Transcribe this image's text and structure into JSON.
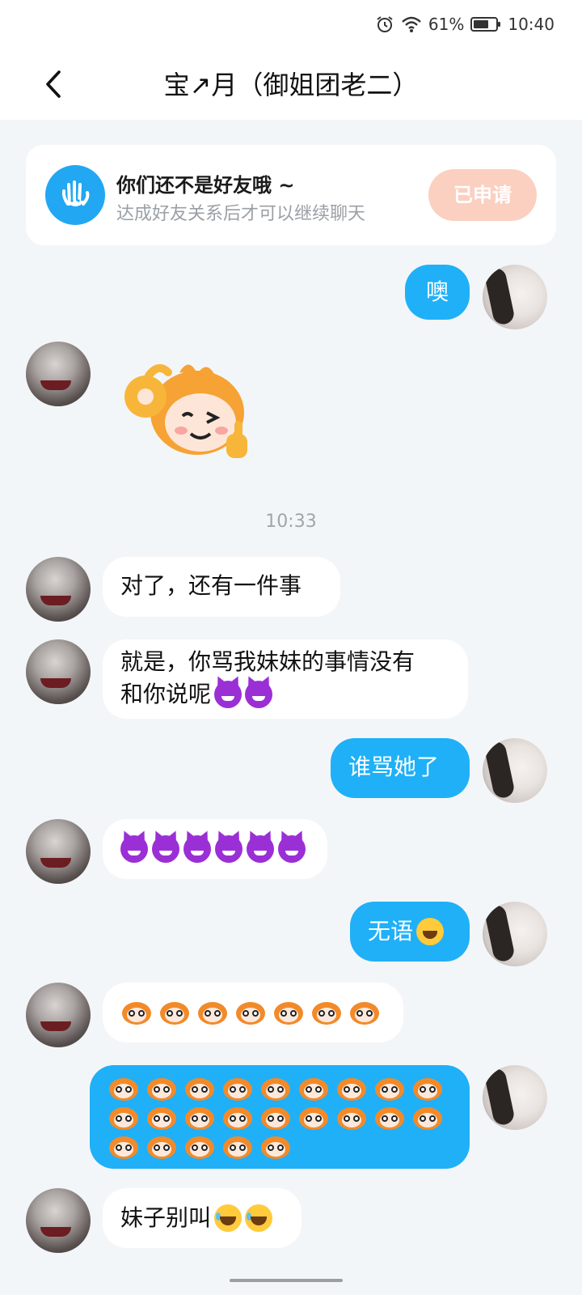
{
  "status": {
    "battery": "61%",
    "time": "10:40",
    "icons": [
      "alarm-icon",
      "wifi-icon",
      "battery-icon"
    ]
  },
  "header": {
    "title": "宝↗月（御姐团老二）",
    "back_icon": "chevron-left-icon"
  },
  "banner": {
    "title": "你们还不是好友哦 ~",
    "subtitle": "达成好友关系后才可以继续聊天",
    "button": "已申请",
    "icon": "hand-wave-icon"
  },
  "chat": {
    "timestamp": "10:33",
    "messages": [
      {
        "side": "right",
        "type": "text",
        "text": "噢"
      },
      {
        "side": "left",
        "type": "sticker",
        "sticker": "monkey-ok-wink-sticker"
      },
      {
        "side": "left",
        "type": "text",
        "text": "对了，还有一件事"
      },
      {
        "side": "left",
        "type": "text",
        "text_line1": "就是，你骂我妹妹的事情没有",
        "text_line2": "和你说呢",
        "emoji": "devil-emoji",
        "emoji_count": 2
      },
      {
        "side": "right",
        "type": "text",
        "text": "谁骂她了"
      },
      {
        "side": "left",
        "type": "emoji",
        "emoji": "devil-emoji",
        "emoji_count": 6
      },
      {
        "side": "right",
        "type": "text",
        "text": "无语",
        "emoji": "sweat-smile-emoji",
        "emoji_count": 1
      },
      {
        "side": "left",
        "type": "emoji",
        "emoji": "monkey-face-emoji",
        "emoji_count": 7
      },
      {
        "side": "right",
        "type": "emoji",
        "emoji": "monkey-face-emoji",
        "emoji_count": 23
      },
      {
        "side": "left",
        "type": "text",
        "text": "妹子别叫",
        "emoji": "tears-of-joy-emoji",
        "emoji_count": 2
      }
    ]
  },
  "colors": {
    "background": "#f3f6f8",
    "outgoing_bubble": "#1fb0f8",
    "incoming_bubble": "#ffffff",
    "banner_icon_bg": "#22a7f2",
    "applied_button": "#fbd0c0"
  }
}
